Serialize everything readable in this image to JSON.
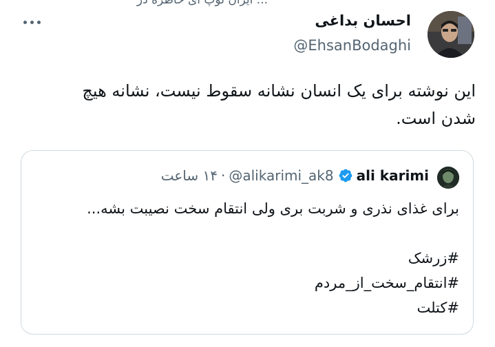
{
  "context": {
    "cut_text": "... ایران توپ ای خاطره در"
  },
  "tweet": {
    "display_name": "احسان بداغی",
    "handle": "@EhsanBodaghi",
    "body": "این نوشته برای یک انسان نشانه سقوط نیست، نشانه هیچ\nشدن است.",
    "more_icon": "more-horizontal-icon"
  },
  "quote": {
    "name": "ali karimi",
    "verified_icon": "verified-badge-icon",
    "verified_color": "#1d9bf0",
    "handle": "@alikarimi_ak8",
    "separator": "·",
    "time": "۱۴ ساعت",
    "body_line": "برای غذای نذری و شربت بری ولی انتقام سخت نصیبت بشه...",
    "hashtags": [
      "#زرشک",
      "#انتقام_سخت_از_مردم",
      "#کتلت"
    ]
  },
  "colors": {
    "text_primary": "#0f1419",
    "text_secondary": "#536471",
    "border": "#cfd9de"
  }
}
